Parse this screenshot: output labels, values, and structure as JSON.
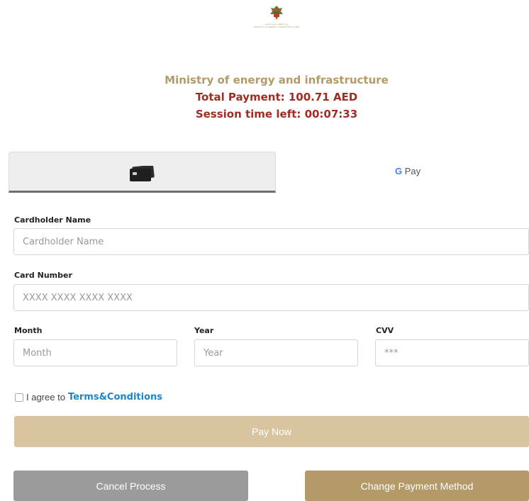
{
  "logo": {
    "icon": "uae-emblem-icon",
    "text_line1": "وزارة الطاقة والبنية التحتية",
    "text_line2": "MINISTRY OF ENERGY & INFRASTRUCTURE"
  },
  "header": {
    "organization": "Ministry of energy and infrastructure",
    "total_payment": "Total Payment: 100.71 AED",
    "session_time": "Session time left: 00:07:33"
  },
  "tabs": [
    {
      "icon": "credit-card-icon",
      "active": true
    },
    {
      "label_g": "G",
      "label_pay": " Pay",
      "active": false
    }
  ],
  "form": {
    "cardholder_label": "Cardholder Name",
    "cardholder_placeholder": "Cardholder Name",
    "card_number_label": "Card Number",
    "card_number_placeholder": "XXXX XXXX XXXX XXXX",
    "month_label": "Month",
    "month_placeholder": "Month",
    "year_label": "Year",
    "year_placeholder": "Year",
    "cvv_label": "CVV",
    "cvv_placeholder": "***"
  },
  "agree": {
    "text": "I agree to",
    "link": "Terms&Conditions"
  },
  "buttons": {
    "pay_now": "Pay Now",
    "cancel": "Cancel Process",
    "change_method": "Change Payment Method"
  },
  "colors": {
    "gold": "#b39a68",
    "red": "#a02c22",
    "light_gold": "#d9c4a0",
    "gray": "#9b9b9b",
    "link": "#1a86c7"
  }
}
